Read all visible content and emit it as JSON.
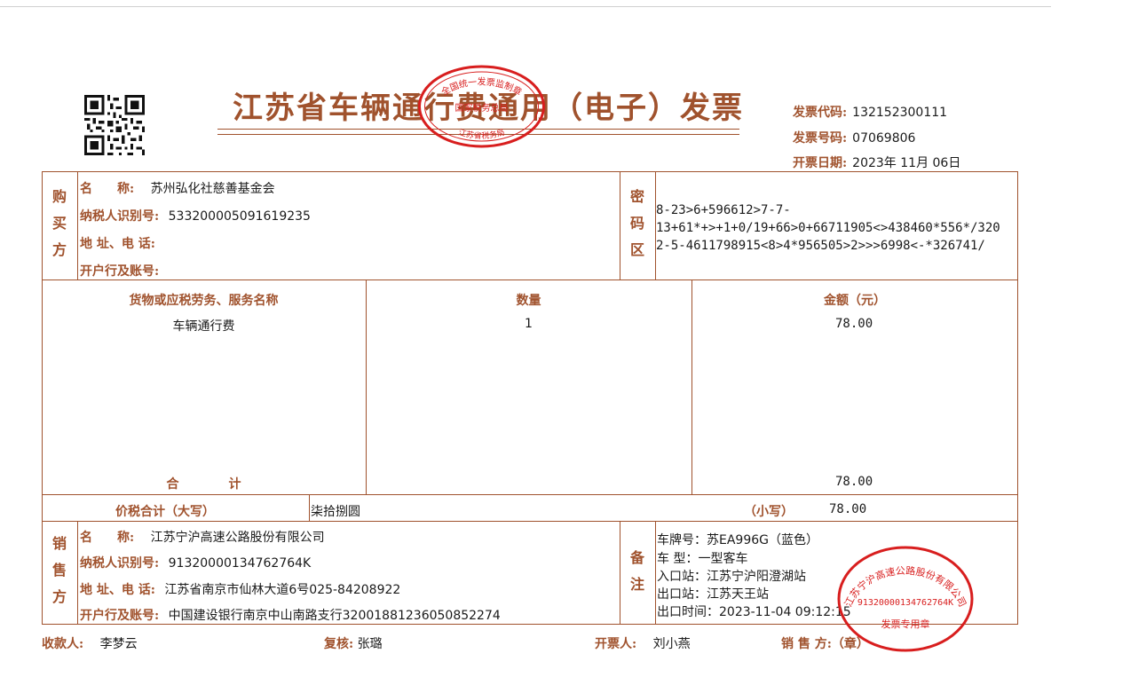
{
  "invoice": {
    "title": "江苏省车辆通行费通用（电子）发票",
    "code_label": "发票代码:",
    "code_value": "132152300111",
    "number_label": "发票号码:",
    "number_value": "07069806",
    "date_label": "开票日期:",
    "date_value": "2023年 11月 06日"
  },
  "buyer": {
    "side_label": "购买方",
    "name_label": "名　　称:",
    "name_value": "苏州弘化社慈善基金会",
    "tax_label": "纳税人识别号:",
    "tax_value": "533200005091619235",
    "address_label": "地 址、电 话:",
    "address_value": "",
    "bank_label": "开户行及账号:",
    "bank_value": ""
  },
  "cipher": {
    "side_label": "密码区",
    "lines": [
      "8-23>6+596612>7-7-",
      "13+61*+>+1+0/19+66>0+66711905<>438460*556*/320",
      "2-5-4611798915<8>4*956505>2>>>6998<-*326741/"
    ]
  },
  "items": {
    "col_name": "货物或应税劳务、服务名称",
    "col_qty": "数量",
    "col_amount": "金额（元）",
    "rows": [
      {
        "name": "车辆通行费",
        "qty": "1",
        "amount": "78.00"
      }
    ],
    "total_label": "合　　　　计",
    "total_amount": "78.00"
  },
  "summary": {
    "label": "价税合计（大写）",
    "upper": "柒拾捌圆",
    "lower_label": "（小写）",
    "lower_value": "78.00"
  },
  "seller": {
    "side_label": "销售方",
    "name_label": "名　　称:",
    "name_value": "江苏宁沪高速公路股份有限公司",
    "tax_label": "纳税人识别号:",
    "tax_value": "91320000134762764K",
    "address_label": "地 址、电 话:",
    "address_value": "江苏省南京市仙林大道6号025-84208922",
    "bank_label": "开户行及账号:",
    "bank_value": "中国建设银行南京中山南路支行32001881236050852274"
  },
  "remarks": {
    "side_label": "备注",
    "plate": "车牌号：苏EA996G（蓝色）",
    "vehicle_type": "车 型：一型客车",
    "entry": "入口站：江苏宁沪阳澄湖站",
    "exit": "出口站：江苏天王站",
    "exit_time": "出口时间：2023-11-04 09:12:15"
  },
  "footer": {
    "payee_label": "收款人:",
    "payee_value": "李梦云",
    "reviewer_label": "复核:",
    "reviewer_value": "张璐",
    "issuer_label": "开票人:",
    "issuer_value": "刘小燕",
    "seller_label": "销 售 方:（章）"
  },
  "stamps": {
    "tax_seal_top": "全国统一发票监制章",
    "tax_seal_middle": "国家税务总局",
    "tax_seal_bottom": "江苏省税务局",
    "company_seal_top": "江苏宁沪高速公路股份有限公司",
    "company_seal_id": "91320000134762764K",
    "company_seal_bottom": "发票专用章",
    "seal_color": "#d81e1e"
  },
  "colors": {
    "label_brown": "#a0522d",
    "text": "#1a1a1a"
  }
}
